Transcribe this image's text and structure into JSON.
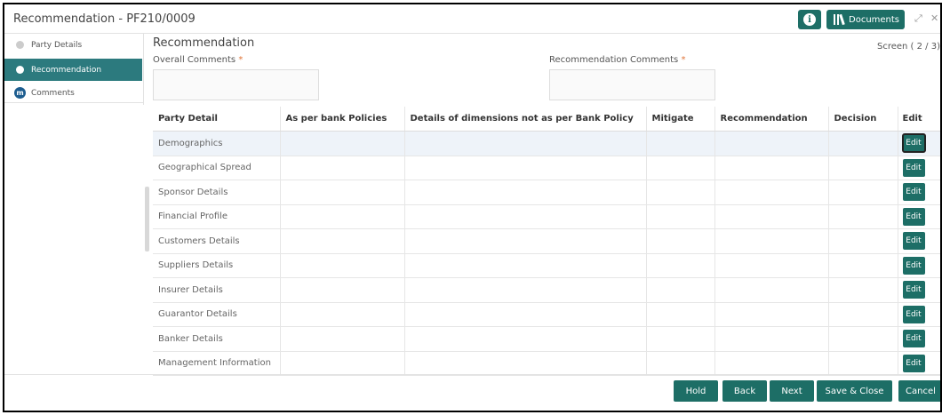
{
  "window": {
    "title": "Recommendation - PF210/0009",
    "documents_label": "Documents",
    "minimize_glyph": "⤢",
    "close_glyph": "✕"
  },
  "sidebar": {
    "items": [
      {
        "label": "Party Details",
        "state": "done"
      },
      {
        "label": "Recommendation",
        "state": "active"
      },
      {
        "label": "Comments",
        "state": "pending",
        "badge": "ⓜ"
      }
    ]
  },
  "main": {
    "title": "Recommendation",
    "screen_indicator": "Screen ( 2 / 3)",
    "overall_comments_label": "Overall Comments",
    "recommendation_comments_label": "Recommendation Comments",
    "required_mark": "*",
    "overall_comments_value": "",
    "recommendation_comments_value": ""
  },
  "table": {
    "columns": [
      "Party Detail",
      "As per bank Policies",
      "Details of dimensions not as per Bank Policy",
      "Mitigate",
      "Recommendation",
      "Decision",
      "Edit"
    ],
    "edit_label": "Edit",
    "rows": [
      "Demographics",
      "Geographical Spread",
      "Sponsor Details",
      "Financial Profile",
      "Customers Details",
      "Suppliers Details",
      "Insurer Details",
      "Guarantor Details",
      "Banker Details",
      "Management Information"
    ]
  },
  "footer": {
    "hold": "Hold",
    "back": "Back",
    "next": "Next",
    "save_close": "Save & Close",
    "cancel": "Cancel"
  },
  "colors": {
    "accent": "#1d6e66",
    "sidebar_active": "#2c7a7e",
    "required": "#e0763a"
  }
}
